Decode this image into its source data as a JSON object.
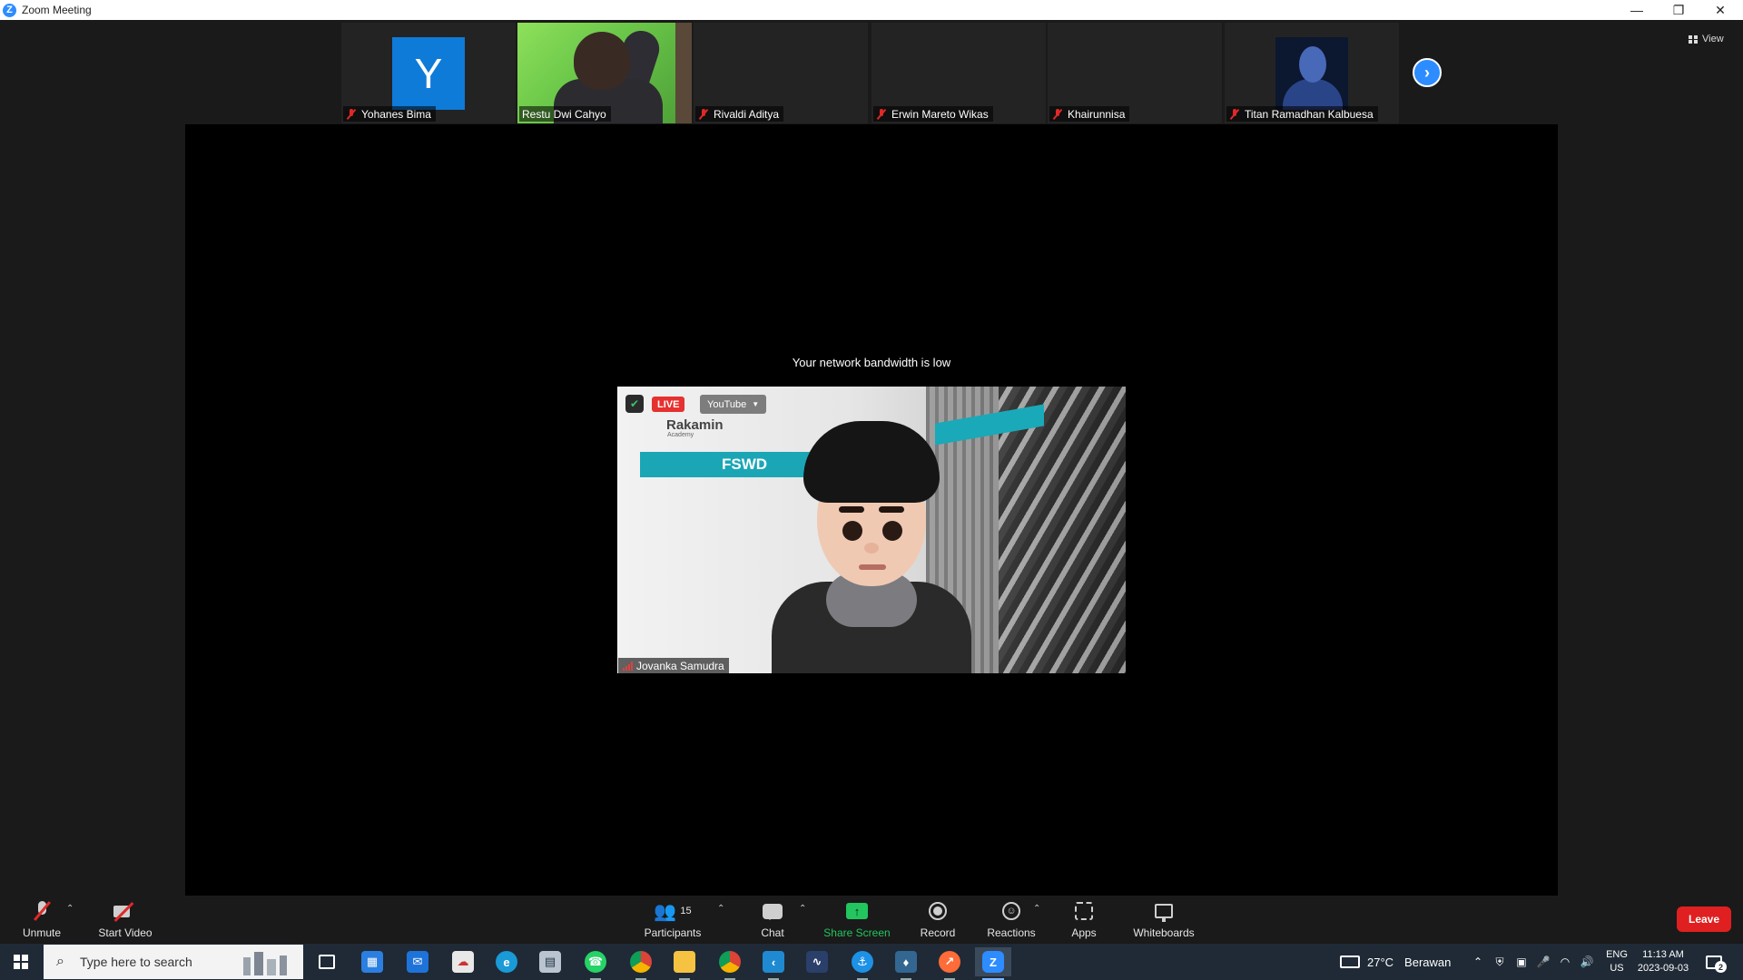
{
  "window": {
    "title": "Zoom Meeting"
  },
  "top_bar": {
    "view_label": "View"
  },
  "participants_strip": [
    {
      "name": "Yohanes Bima",
      "avatar_letter": "Y",
      "muted": true
    },
    {
      "name": "Restu Dwi Cahyo",
      "muted": false
    },
    {
      "name": "Rivaldi Aditya",
      "muted": true
    },
    {
      "name": "Erwin Mareto Wikas",
      "muted": true
    },
    {
      "name": "Khairunnisa",
      "muted": true
    },
    {
      "name": "Titan Ramadhan Kalbuesa",
      "muted": true
    }
  ],
  "main_video": {
    "notice": "Your network bandwidth is low",
    "speaker_name": "Jovanka Samudra",
    "live_badge": "LIVE",
    "stream_target": "YouTube",
    "overlay_brand": "Rakamin",
    "overlay_brand_sub": "Academy",
    "overlay_banner": "FSWD"
  },
  "toolbar": {
    "unmute": "Unmute",
    "start_video": "Start Video",
    "participants": "Participants",
    "participants_count": "15",
    "chat": "Chat",
    "share_screen": "Share Screen",
    "record": "Record",
    "reactions": "Reactions",
    "apps": "Apps",
    "whiteboards": "Whiteboards",
    "leave": "Leave",
    "colors": {
      "share": "#22c55e",
      "leave": "#e02020",
      "accent": "#2d8cff",
      "muted": "#e02828"
    }
  },
  "taskbar": {
    "search_placeholder": "Type here to search",
    "weather_temp": "27°C",
    "weather_condition": "Berawan",
    "lang_line1": "ENG",
    "lang_line2": "US",
    "time": "11:13 AM",
    "date": "2023-09-03",
    "notification_count": "2",
    "apps": [
      "task-view",
      "microsoft-store",
      "mail",
      "app-cloud",
      "edge",
      "app-generic",
      "whatsapp",
      "chrome",
      "file-explorer",
      "chrome-alt",
      "vscode",
      "app-wave",
      "docker",
      "postgresql",
      "postman",
      "zoom"
    ]
  }
}
